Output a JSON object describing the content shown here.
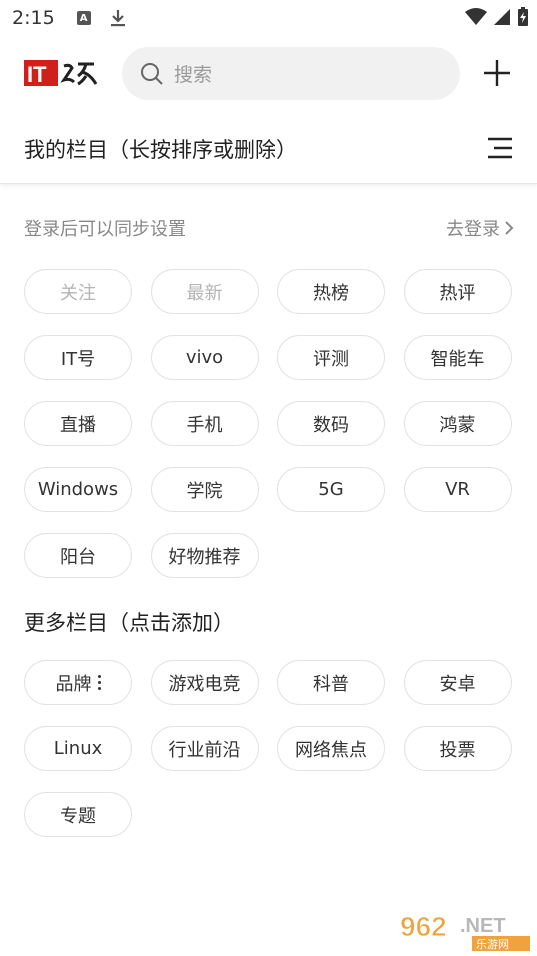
{
  "status_bar": {
    "time": "2:15",
    "badge_letter": "A"
  },
  "header": {
    "logo_text": "IT之家",
    "search_placeholder": "搜索"
  },
  "my_columns": {
    "title": "我的栏目（长按排序或删除）",
    "login_hint": "登录后可以同步设置",
    "login_link": "去登录",
    "items": [
      {
        "label": "关注",
        "muted": true
      },
      {
        "label": "最新",
        "muted": true
      },
      {
        "label": "热榜"
      },
      {
        "label": "热评"
      },
      {
        "label": "IT号"
      },
      {
        "label": "vivo"
      },
      {
        "label": "评测"
      },
      {
        "label": "智能车"
      },
      {
        "label": "直播"
      },
      {
        "label": "手机"
      },
      {
        "label": "数码"
      },
      {
        "label": "鸿蒙"
      },
      {
        "label": "Windows"
      },
      {
        "label": "学院"
      },
      {
        "label": "5G"
      },
      {
        "label": "VR"
      },
      {
        "label": "阳台"
      },
      {
        "label": "好物推荐"
      }
    ]
  },
  "more_columns": {
    "title": "更多栏目（点击添加）",
    "items": [
      {
        "label": "品牌",
        "has_menu": true
      },
      {
        "label": "游戏电竞"
      },
      {
        "label": "科普"
      },
      {
        "label": "安卓"
      },
      {
        "label": "Linux"
      },
      {
        "label": "行业前沿"
      },
      {
        "label": "网络焦点"
      },
      {
        "label": "投票"
      },
      {
        "label": "专题"
      }
    ]
  },
  "watermark": {
    "text": "962.NET",
    "sub": "乐游网"
  },
  "colors": {
    "brand_red": "#d0201b",
    "chip_border": "#e2e2e2",
    "muted_text": "#b4b4b4"
  }
}
